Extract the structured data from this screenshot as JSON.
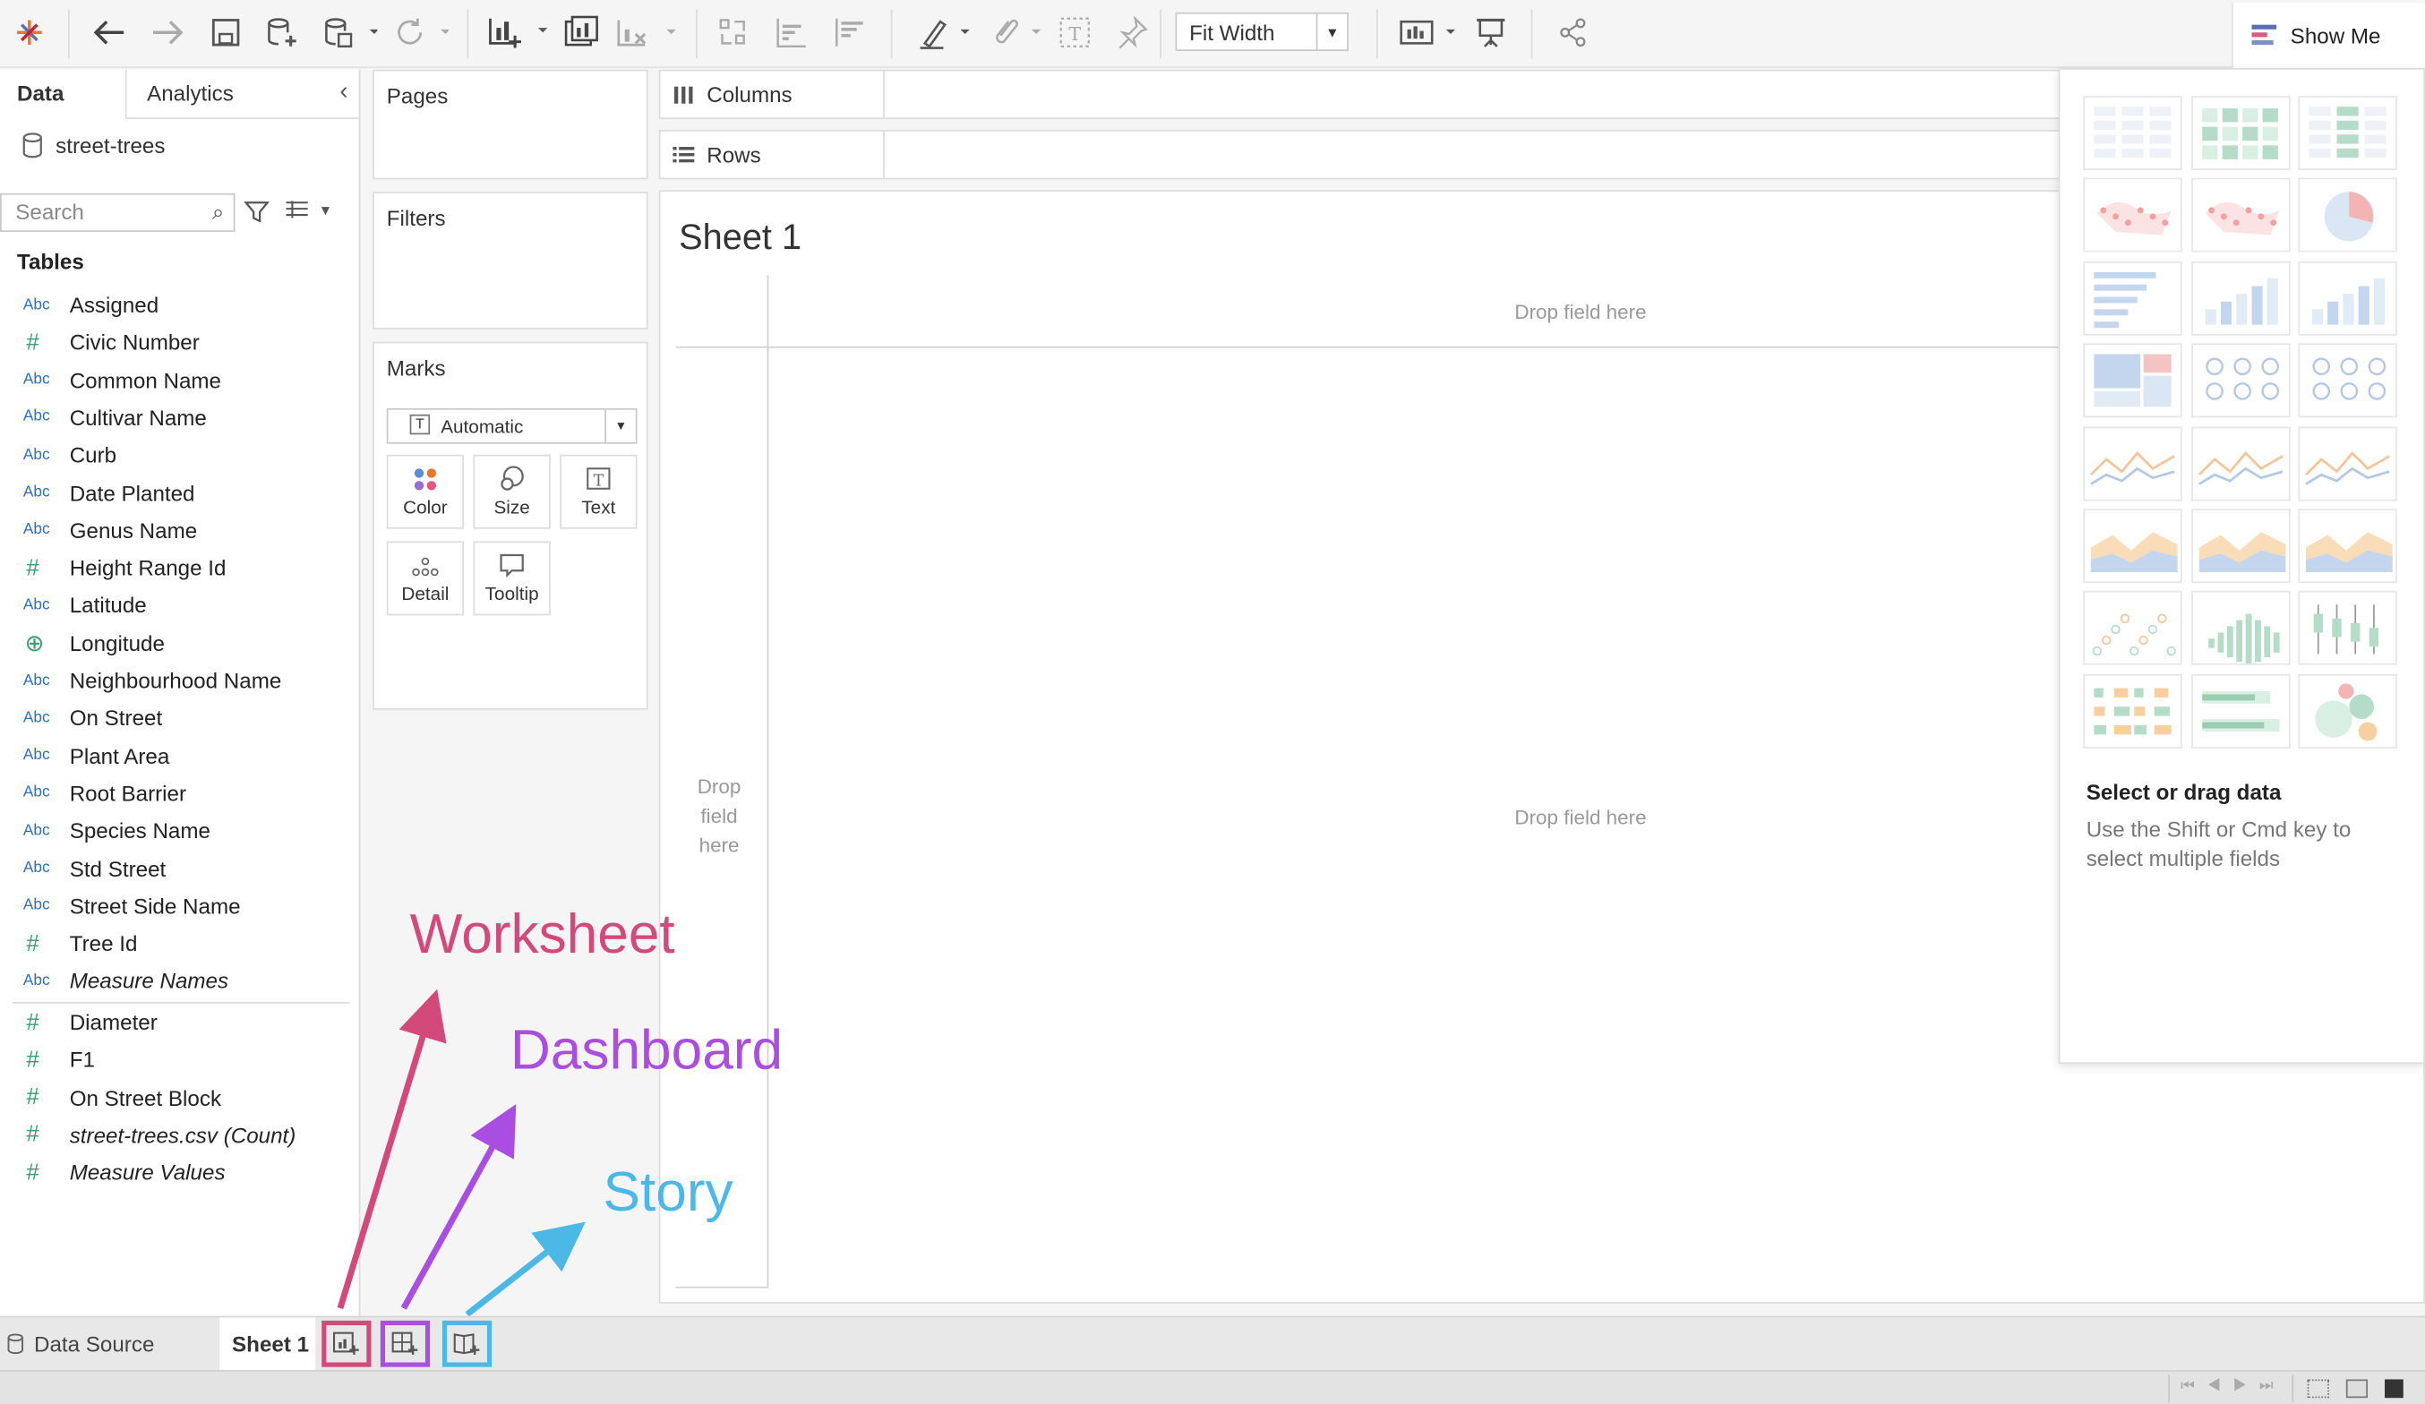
{
  "toolbar": {
    "fit": "Fit Width",
    "showme": "Show Me"
  },
  "data_pane": {
    "tabs": [
      "Data",
      "Analytics"
    ],
    "datasource": "street-trees",
    "search_placeholder": "Search",
    "tables_label": "Tables",
    "fields": [
      {
        "type": "Abc",
        "name": "Assigned"
      },
      {
        "type": "#",
        "name": "Civic Number"
      },
      {
        "type": "Abc",
        "name": "Common Name"
      },
      {
        "type": "Abc",
        "name": "Cultivar Name"
      },
      {
        "type": "Abc",
        "name": "Curb"
      },
      {
        "type": "Abc",
        "name": "Date Planted"
      },
      {
        "type": "Abc",
        "name": "Genus Name"
      },
      {
        "type": "#",
        "name": "Height Range Id"
      },
      {
        "type": "Abc",
        "name": "Latitude"
      },
      {
        "type": "geo",
        "name": "Longitude"
      },
      {
        "type": "Abc",
        "name": "Neighbourhood Name"
      },
      {
        "type": "Abc",
        "name": "On Street"
      },
      {
        "type": "Abc",
        "name": "Plant Area"
      },
      {
        "type": "Abc",
        "name": "Root Barrier"
      },
      {
        "type": "Abc",
        "name": "Species Name"
      },
      {
        "type": "Abc",
        "name": "Std Street"
      },
      {
        "type": "Abc",
        "name": "Street Side Name"
      },
      {
        "type": "#",
        "name": "Tree Id"
      },
      {
        "type": "Abc",
        "name": "Measure Names",
        "italic": true
      }
    ],
    "measures": [
      {
        "type": "#",
        "name": "Diameter"
      },
      {
        "type": "#",
        "name": "F1"
      },
      {
        "type": "#",
        "name": "On Street Block"
      },
      {
        "type": "#",
        "name": "street-trees.csv (Count)",
        "italic": true
      },
      {
        "type": "#",
        "name": "Measure Values",
        "italic": true
      }
    ]
  },
  "shelves": {
    "pages": "Pages",
    "filters": "Filters",
    "marks": "Marks",
    "mark_type": "Automatic",
    "mark_buttons": [
      "Color",
      "Size",
      "Text",
      "Detail",
      "Tooltip"
    ],
    "columns": "Columns",
    "rows": "Rows"
  },
  "canvas": {
    "sheet_title": "Sheet 1",
    "drop_top": "Drop field here",
    "drop_left": "Drop field here",
    "drop_center": "Drop field here"
  },
  "showme_panel": {
    "heading": "Select or drag data",
    "hint": "Use the Shift or Cmd key to select multiple fields"
  },
  "bottom_tabs": {
    "data_source": "Data Source",
    "sheet": "Sheet 1"
  },
  "annotations": {
    "worksheet": "Worksheet",
    "dashboard": "Dashboard",
    "story": "Story",
    "colors": {
      "worksheet": "#d2497a",
      "dashboard": "#a94ee0",
      "story": "#4bb8e6"
    }
  }
}
